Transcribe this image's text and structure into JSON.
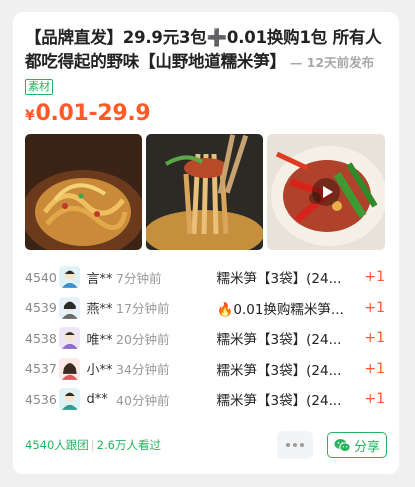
{
  "post": {
    "title": "【品牌直发】29.9元3包➕0.01换购1包 所有人都吃得起的野味【山野地道糯米笋】",
    "posted": "12天前发布",
    "tag": "素材",
    "price_symbol": "¥",
    "price": "0.01-29.9"
  },
  "images": [
    {
      "icon": "food-photo-bamboo-shoots-bowl"
    },
    {
      "icon": "food-photo-bamboo-shoots-chopsticks"
    },
    {
      "icon": "food-video-spicy-dish",
      "has_video": true
    }
  ],
  "orders": [
    {
      "num": "4540",
      "name": "言**",
      "time": "7分钟前",
      "product": "糯米笋【3袋】(24...",
      "qty": "+1"
    },
    {
      "num": "4539",
      "name": "燕**",
      "time": "17分钟前",
      "product": "🔥0.01换购糯米笋...",
      "qty": "+1"
    },
    {
      "num": "4538",
      "name": "唯**",
      "time": "20分钟前",
      "product": "糯米笋【3袋】(24...",
      "qty": "+1"
    },
    {
      "num": "4537",
      "name": "小**",
      "time": "34分钟前",
      "product": "糯米笋【3袋】(24...",
      "qty": "+1"
    },
    {
      "num": "4536",
      "name": "d**",
      "time": "40分钟前",
      "product": "糯米笋【3袋】(24...",
      "qty": "+1"
    }
  ],
  "footer": {
    "joined": "4540人跟团",
    "separator": "|",
    "viewed": "2.6万人看过",
    "share_label": "分享"
  },
  "colors": {
    "accent_green": "#29b35c",
    "price_orange": "#ff5a28"
  }
}
